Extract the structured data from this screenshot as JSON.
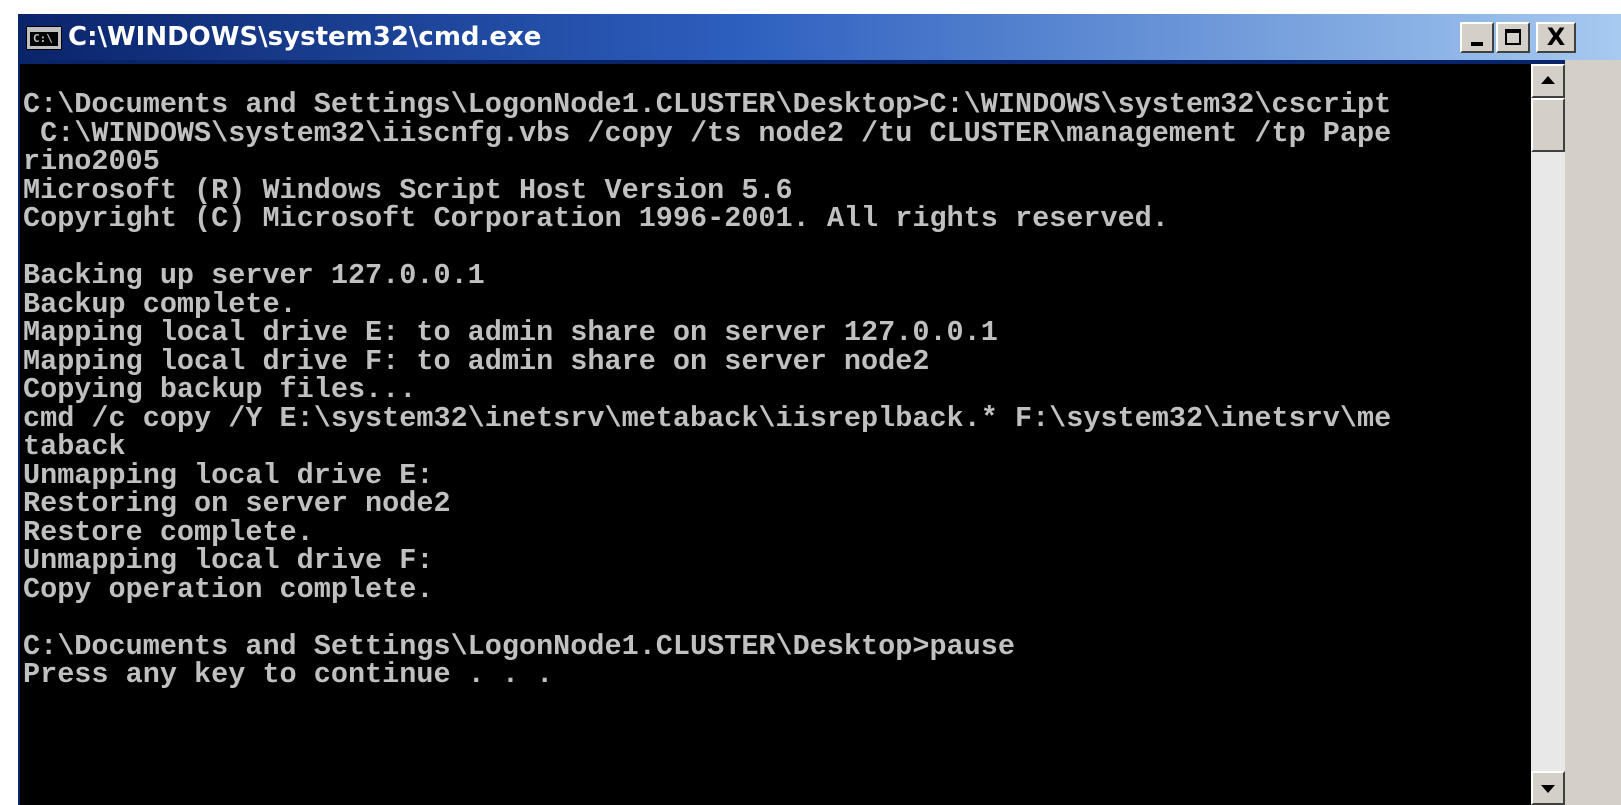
{
  "window": {
    "title": "C:\\WINDOWS\\system32\\cmd.exe",
    "icon_name": "cmd-icon",
    "icon_text": "C:\\",
    "buttons": {
      "minimize": "minimize-icon",
      "maximize": "maximize-icon",
      "close": "close-icon"
    },
    "close_glyph": "X"
  },
  "console": {
    "lines": [
      "C:\\Documents and Settings\\LogonNode1.CLUSTER\\Desktop>C:\\WINDOWS\\system32\\cscript",
      " C:\\WINDOWS\\system32\\iiscnfg.vbs /copy /ts node2 /tu CLUSTER\\management /tp Pape",
      "rino2005",
      "Microsoft (R) Windows Script Host Version 5.6",
      "Copyright (C) Microsoft Corporation 1996-2001. All rights reserved.",
      "",
      "Backing up server 127.0.0.1",
      "Backup complete.",
      "Mapping local drive E: to admin share on server 127.0.0.1",
      "Mapping local drive F: to admin share on server node2",
      "Copying backup files...",
      "cmd /c copy /Y E:\\system32\\inetsrv\\metaback\\iisreplback.* F:\\system32\\inetsrv\\me",
      "taback",
      "Unmapping local drive E:",
      "Restoring on server node2",
      "Restore complete.",
      "Unmapping local drive F:",
      "Copy operation complete.",
      "",
      "C:\\Documents and Settings\\LogonNode1.CLUSTER\\Desktop>pause",
      "Press any key to continue . . ."
    ]
  },
  "colors": {
    "title_bar_start": "#0a246a",
    "title_bar_end": "#a6caf0",
    "console_background": "#000000",
    "console_text": "#c0c0c0",
    "chrome": "#d4d0c8"
  }
}
